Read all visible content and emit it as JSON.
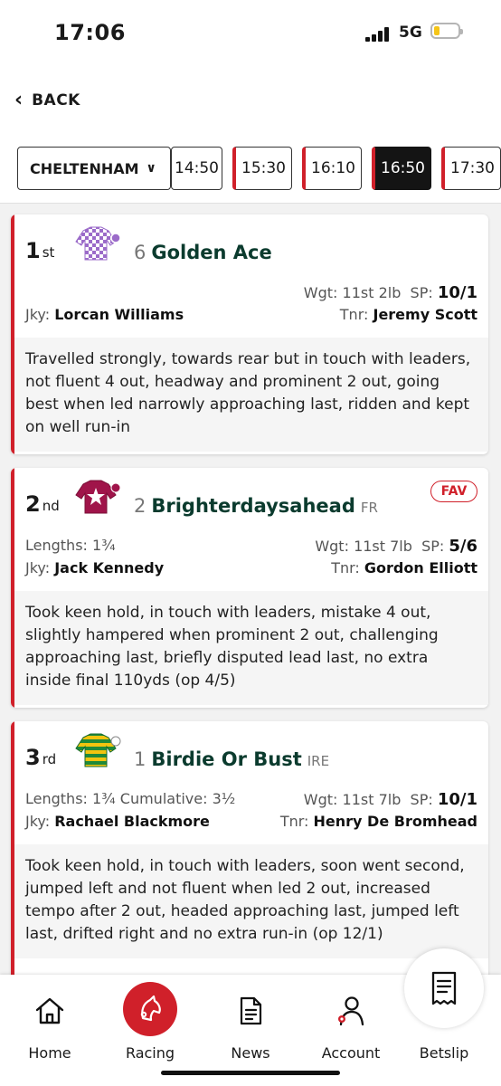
{
  "status": {
    "time": "17:06",
    "network": "5G"
  },
  "header": {
    "back_label": "BACK",
    "venue": "CHELTENHAM",
    "race_times": [
      "14:50",
      "15:30",
      "16:10",
      "16:50",
      "17:30"
    ],
    "selected_time": "16:50"
  },
  "results": [
    {
      "position": "1",
      "ordinal": "st",
      "number": "6",
      "name": "Golden Ace",
      "nationality": "",
      "fav": "",
      "lengths": "",
      "weight_label": "Wgt:",
      "weight": "11st 2lb",
      "sp_label": "SP:",
      "sp": "10/1",
      "jockey_label": "Jky:",
      "jockey": "Lorcan Williams",
      "trainer_label": "Tnr:",
      "trainer": "Jeremy Scott",
      "comment": "Travelled strongly, towards rear but in touch with leaders, not fluent 4 out, headway and prominent 2 out, going best when led narrowly approaching last, ridden and kept on well run-in",
      "silks_colors": {
        "primary": "#9b6bc9",
        "secondary": "#ffffff"
      }
    },
    {
      "position": "2",
      "ordinal": "nd",
      "number": "2",
      "name": "Brighterdaysahead",
      "nationality": "FR",
      "fav": "FAV",
      "lengths": "Lengths: 1¾",
      "weight_label": "Wgt:",
      "weight": "11st 7lb",
      "sp_label": "SP:",
      "sp": "5/6",
      "jockey_label": "Jky:",
      "jockey": "Jack Kennedy",
      "trainer_label": "Tnr:",
      "trainer": "Gordon Elliott",
      "comment": "Took keen hold, in touch with leaders, mistake 4 out, slightly hampered when prominent 2 out, challenging approaching last, briefly disputed lead last, no extra inside final 110yds (op 4/5)",
      "silks_colors": {
        "primary": "#a0144a",
        "secondary": "#ffffff"
      }
    },
    {
      "position": "3",
      "ordinal": "rd",
      "number": "1",
      "name": "Birdie Or Bust",
      "nationality": "IRE",
      "fav": "",
      "lengths": "Lengths: 1¾ Cumulative: 3½",
      "weight_label": "Wgt:",
      "weight": "11st 7lb",
      "sp_label": "SP:",
      "sp": "10/1",
      "jockey_label": "Jky:",
      "jockey": "Rachael Blackmore",
      "trainer_label": "Tnr:",
      "trainer": "Henry De Bromhead",
      "comment": "Took keen hold, in touch with leaders, soon went second, jumped left and not fluent when led 2 out, increased tempo after 2 out, headed approaching last, jumped left last, drifted right and no extra run-in (op 12/1)",
      "silks_colors": {
        "primary": "#1f8a3a",
        "secondary": "#f2c40f"
      }
    }
  ],
  "tabbar": {
    "home": "Home",
    "racing": "Racing",
    "news": "News",
    "account": "Account",
    "betslip": "Betslip"
  },
  "colors": {
    "accent": "#d0202a",
    "name_text": "#0b3b2e"
  }
}
